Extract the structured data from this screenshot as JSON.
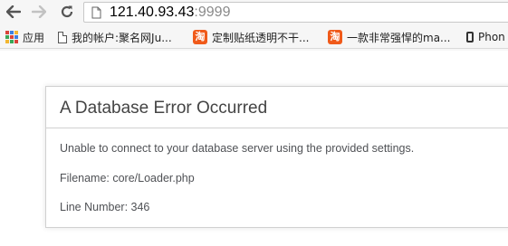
{
  "browser": {
    "url_host": "121.40.93.43",
    "url_port": ":9999",
    "bookmarks": [
      {
        "label": "应用",
        "icon": "apps-grid-icon"
      },
      {
        "label": "我的帐户:聚名网Ju...",
        "icon": "page-icon"
      },
      {
        "label": "定制贴纸透明不干...",
        "icon": "taobao-icon"
      },
      {
        "label": "一款非常强悍的ma...",
        "icon": "taobao-icon"
      },
      {
        "label": "Phon",
        "icon": "phone-icon"
      }
    ],
    "taobao_glyph": "淘",
    "colors": {
      "taobao": "#f05a1a",
      "url_port": "#8a8a8a"
    }
  },
  "error": {
    "title": "A Database Error Occurred",
    "message": "Unable to connect to your database server using the provided settings.",
    "filename": "Filename: core/Loader.php",
    "line_number": "Line Number: 346"
  }
}
